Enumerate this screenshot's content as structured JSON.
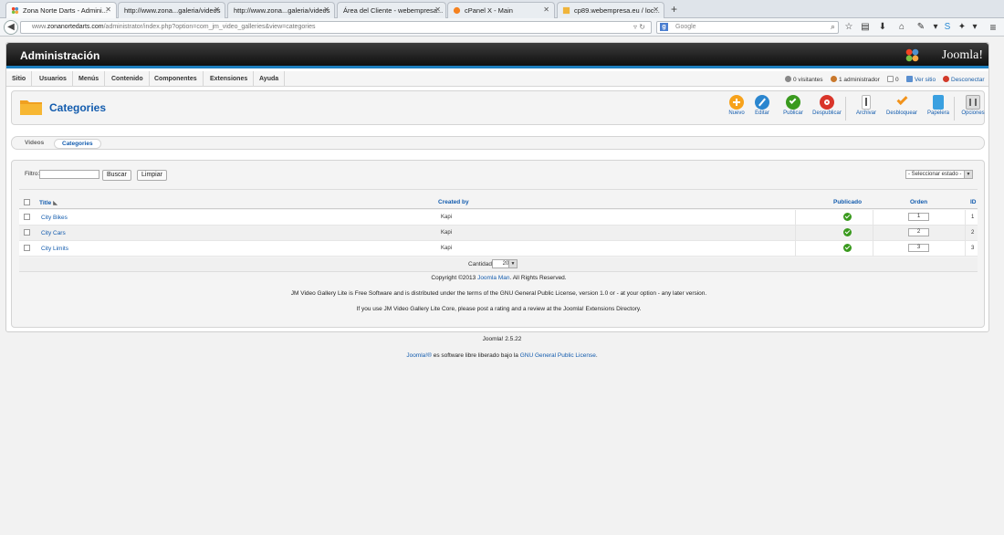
{
  "browser": {
    "tabs": [
      {
        "title": "Zona Norte Darts - Admini...",
        "active": true
      },
      {
        "title": "http://www.zona...galeria/videos"
      },
      {
        "title": "http://www.zona...galeria/videos"
      },
      {
        "title": "Área del Cliente - webempresa..."
      },
      {
        "title": "cPanel X - Main"
      },
      {
        "title": "cp89.webempresa.eu / loc..."
      }
    ],
    "url_prefix": "www.",
    "url_host": "zonanortedarts.com",
    "url_path": "/administrator/index.php?option=com_jm_video_galleries&view=categories",
    "search_placeholder": "Google"
  },
  "header": {
    "title": "Administración",
    "logo_text": "Joomla!"
  },
  "menu": [
    "Sitio",
    "Usuarios",
    "Menús",
    "Contenido",
    "Componentes",
    "Extensiones",
    "Ayuda"
  ],
  "status": {
    "visitors": "0 visitantes",
    "admins": "1 administrador",
    "messages": "0",
    "view_site": "Ver sitio",
    "logout": "Desconectar"
  },
  "toolbar": {
    "title": "Categories",
    "buttons": {
      "new": "Nuevo",
      "edit": "Editar",
      "publish": "Publicar",
      "unpublish": "Despublicar",
      "archive": "Archivar",
      "unlock": "Desbloquear",
      "trash": "Papelera",
      "options": "Opciones"
    }
  },
  "subtabs": [
    "Videos",
    "Categories"
  ],
  "filter": {
    "label": "Filtro:",
    "value": "",
    "search_button": "Buscar",
    "clear_button": "Limpiar",
    "state_select": "- Seleccionar estado -"
  },
  "table": {
    "columns": {
      "title": "Title",
      "created_by": "Created by",
      "published": "Publicado",
      "order": "Orden",
      "id": "ID"
    },
    "rows": [
      {
        "title": "City Bikes",
        "created_by": "Kapi",
        "order": "1",
        "id": "1"
      },
      {
        "title": "City Cars",
        "created_by": "Kapi",
        "order": "2",
        "id": "2"
      },
      {
        "title": "City Limits",
        "created_by": "Kapi",
        "order": "3",
        "id": "3"
      }
    ]
  },
  "pager": {
    "label": "Cantidad",
    "value": "20"
  },
  "copyright": {
    "prefix": "Copyright ©2013",
    "link": "Joomla Man",
    "suffix": ". All Rights Reserved."
  },
  "license_text": "JM Video Gallery Lite is Free Software and is distributed under the terms of the GNU General Public License, version 1.0 or - at your option - any later version.",
  "review_text": "If you use JM Video Gallery Lite Core, please post a rating and a review at the Joomla! Extensions Directory.",
  "footer": {
    "version": "Joomla! 2.5.22",
    "joomla_link": "Joomla!®",
    "middle": "es software libre liberado bajo la",
    "license_link": "GNU General Public License",
    "end": "."
  },
  "colors": {
    "accent": "#135cae",
    "published": "#3a9a1e",
    "adminbar": "#1a1a1a"
  }
}
